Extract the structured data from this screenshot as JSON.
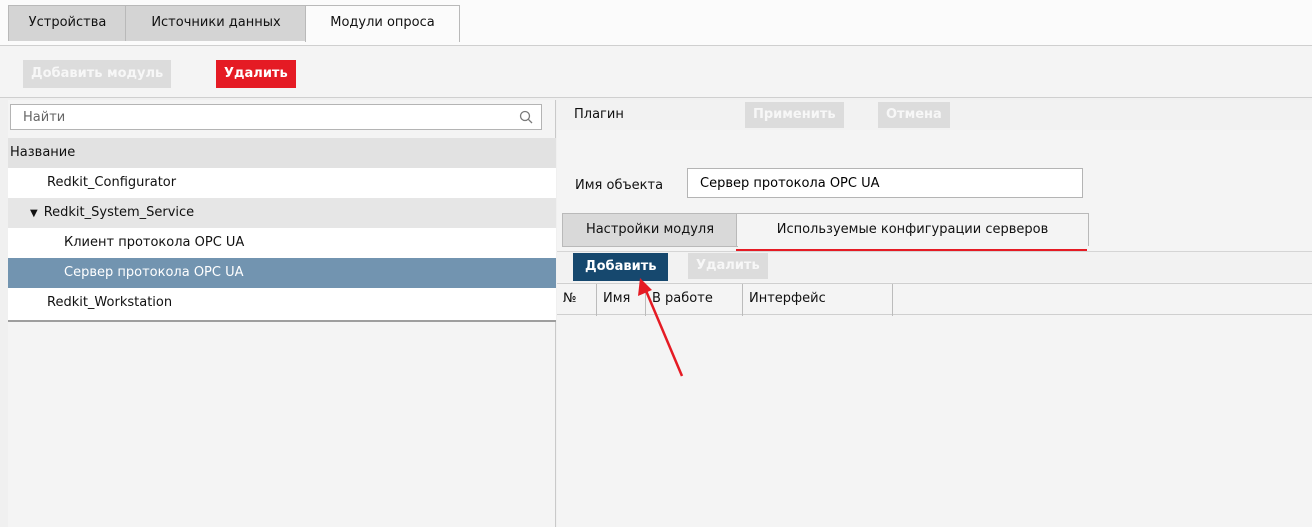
{
  "tabs": [
    {
      "label": "Устройства",
      "active": false
    },
    {
      "label": "Источники данных",
      "active": false
    },
    {
      "label": "Модули опроса",
      "active": true
    }
  ],
  "toolbar": {
    "add_label": "Добавить модуль",
    "delete_label": "Удалить"
  },
  "search": {
    "placeholder": "Найти",
    "icon": "search-icon"
  },
  "tree": {
    "header": "Название",
    "items": [
      {
        "label": "Redkit_Configurator",
        "level": 1
      },
      {
        "label": "Redkit_System_Service",
        "level": 0,
        "expanded": true
      },
      {
        "label": "Клиент протокола OPC UA",
        "level": 2
      },
      {
        "label": "Сервер протокола OPC UA",
        "level": 2,
        "selected": true
      },
      {
        "label": "Redkit_Workstation",
        "level": 1
      }
    ]
  },
  "plugin": {
    "label": "Плагин",
    "apply_label": "Применить",
    "cancel_label": "Отмена"
  },
  "object": {
    "label": "Имя объекта",
    "value": "Сервер протокола OPC UA"
  },
  "subtabs": [
    {
      "label": "Настройки модуля",
      "active": false
    },
    {
      "label": "Используемые конфигурации серверов",
      "active": true
    }
  ],
  "subtoolbar": {
    "add_label": "Добавить",
    "delete_label": "Удалить"
  },
  "table": {
    "columns": [
      "№",
      "Имя",
      "В работе",
      "Интерфейс"
    ]
  },
  "colors": {
    "danger": "#e51b24",
    "primary": "#16486e",
    "selection": "#7294b0",
    "annotation": "#e51b24"
  }
}
